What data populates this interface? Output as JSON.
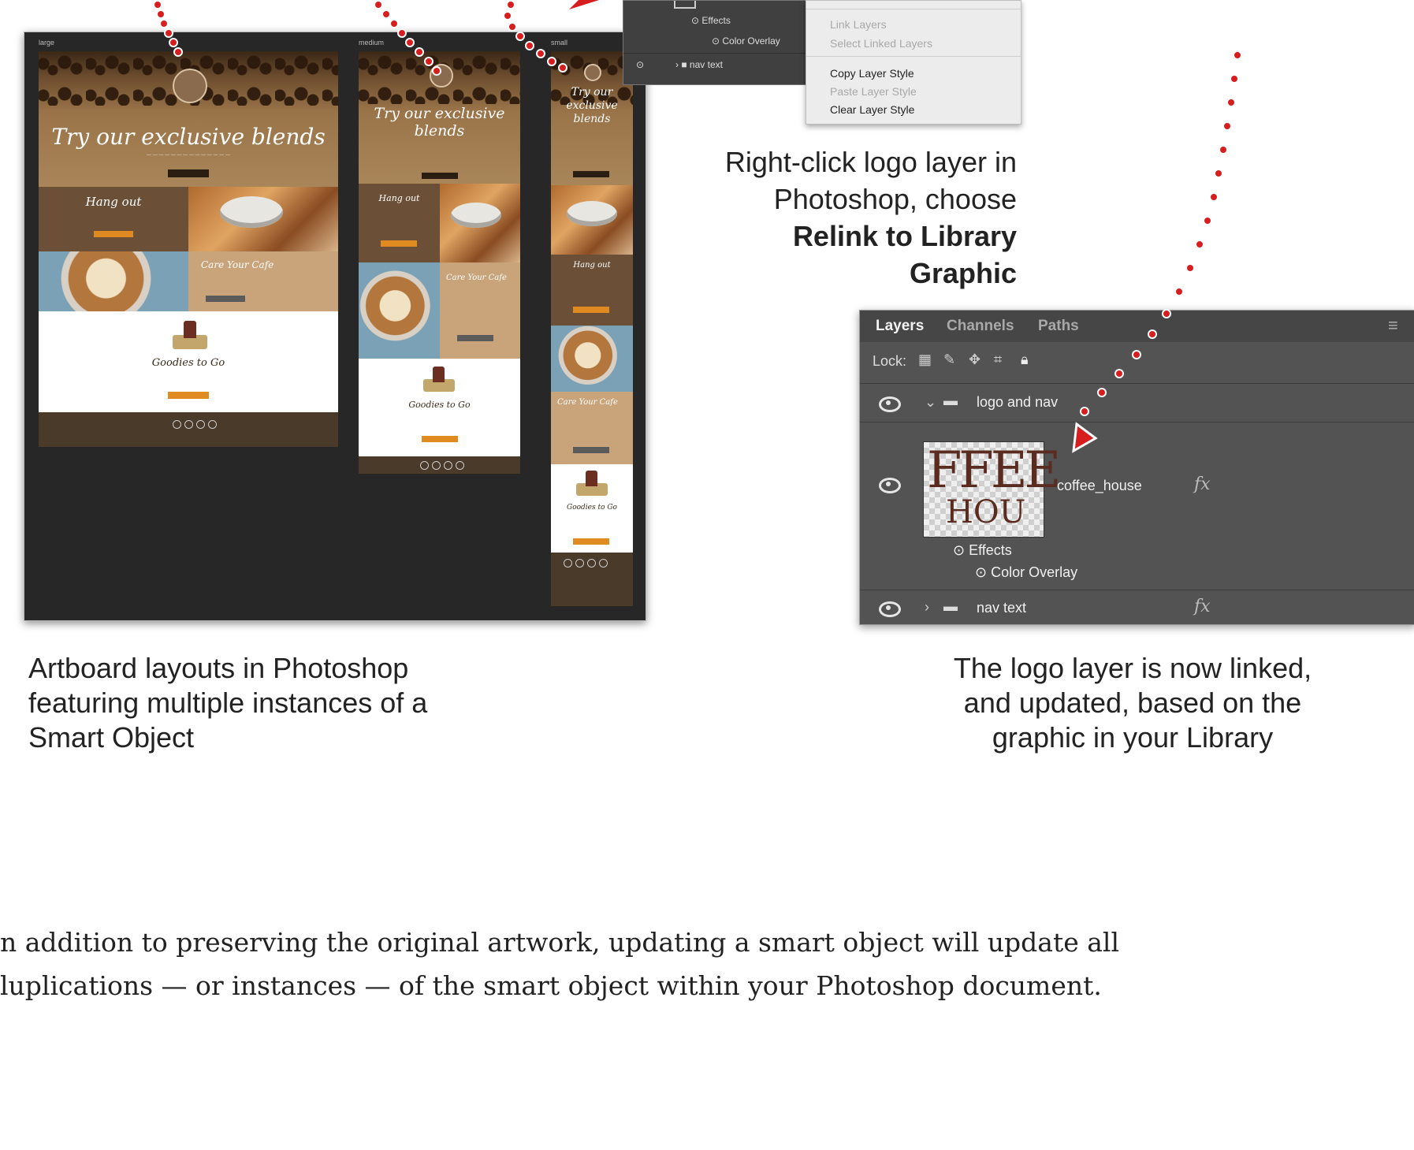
{
  "artboards": {
    "labels": [
      "large",
      "medium",
      "small"
    ],
    "hero_title_large": "Try our exclusive blends",
    "hero_title_small": "Try our exclusive blends",
    "section_hang": "Hang out",
    "section_care": "Care Your Cafe",
    "section_goodies": "Goodies to Go",
    "caption": [
      "Artboard layouts in Photoshop",
      "featuring multiple instances of a",
      "Smart Object"
    ]
  },
  "context": {
    "layer_rows": [
      "Effects",
      "Color Overlay",
      "nav text"
    ],
    "menu_items": [
      {
        "label": "Link Layers",
        "enabled": false
      },
      {
        "label": "Select Linked Layers",
        "enabled": false
      },
      {
        "label": "Copy Layer Style",
        "enabled": true
      },
      {
        "label": "Paste Layer Style",
        "enabled": false
      },
      {
        "label": "Clear Layer Style",
        "enabled": true
      }
    ],
    "caption_line1": "Right-click logo layer in",
    "caption_line2": "Photoshop, choose",
    "caption_bold": "Relink to Library Graphic"
  },
  "layers_panel": {
    "tabs": [
      "Layers",
      "Channels",
      "Paths"
    ],
    "lock_label": "Lock:",
    "group_name": "logo and nav",
    "layer_name": "coffee_house",
    "logo_text_top": "FFEE",
    "logo_text_bottom": "HOU",
    "effects_label": "Effects",
    "overlay_label": "Color Overlay",
    "nav_text": "nav text",
    "fx": "fx",
    "caption": [
      "The logo layer is now linked,",
      "and updated, based on the",
      "graphic in your Library"
    ]
  },
  "paragraph": [
    "n addition to preserving the original artwork, updating a smart object will update all",
    "luplications — or instances — of the smart object within your Photoshop document."
  ],
  "colors": {
    "accent_red": "#d71d1d",
    "panel_bg": "#535353",
    "menu_bg": "#ececec"
  }
}
